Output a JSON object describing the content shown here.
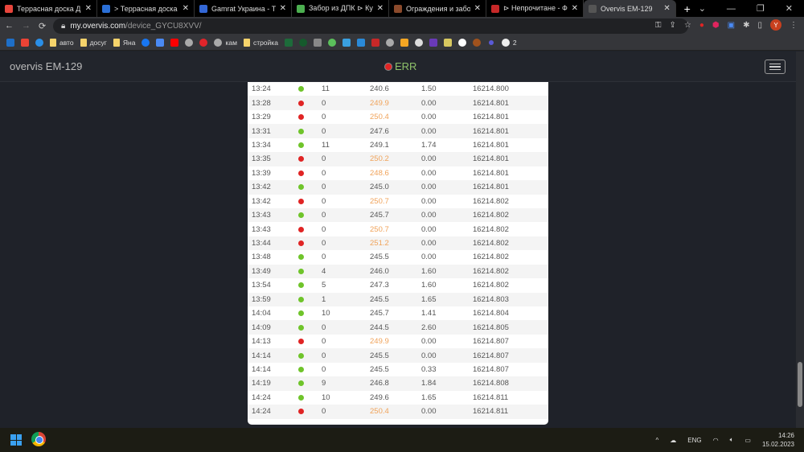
{
  "browser": {
    "tabs": [
      {
        "title": "Террасная доска ДПК I",
        "color": "#e8453c"
      },
      {
        "title": "> Террасная доска • К",
        "color": "#2a6fd6"
      },
      {
        "title": "Gamrat Украина - Терр",
        "color": "#3367d6"
      },
      {
        "title": "Забор из ДПК ⊳ Купит",
        "color": "#4caf50"
      },
      {
        "title": "Ограждения и заборы",
        "color": "#8b4a2b"
      },
      {
        "title": "⊳ Непрочитане - Фору",
        "color": "#c62828"
      },
      {
        "title": "Overvis EM-129",
        "color": "#555",
        "active": true
      }
    ],
    "url_host": "my.overvis.com",
    "url_path": "/device_GYCU8XVV/",
    "profile_initial": "Y",
    "bookmarks": [
      "авто",
      "досуг",
      "Яна",
      "кам",
      "стройка"
    ],
    "bookmark_count": "2"
  },
  "app": {
    "brand": "overvis EM-129",
    "status": "ERR"
  },
  "table": {
    "rows": [
      [
        "13:24",
        "ok",
        "11",
        "240.6",
        "1.50",
        "16214.800"
      ],
      [
        "13:28",
        "err",
        "0",
        "249.9",
        "0.00",
        "16214.801"
      ],
      [
        "13:29",
        "err",
        "0",
        "250.4",
        "0.00",
        "16214.801"
      ],
      [
        "13:31",
        "ok",
        "0",
        "247.6",
        "0.00",
        "16214.801"
      ],
      [
        "13:34",
        "ok",
        "11",
        "249.1",
        "1.74",
        "16214.801"
      ],
      [
        "13:35",
        "err",
        "0",
        "250.2",
        "0.00",
        "16214.801"
      ],
      [
        "13:39",
        "err",
        "0",
        "248.6",
        "0.00",
        "16214.801"
      ],
      [
        "13:42",
        "ok",
        "0",
        "245.0",
        "0.00",
        "16214.801"
      ],
      [
        "13:42",
        "err",
        "0",
        "250.7",
        "0.00",
        "16214.802"
      ],
      [
        "13:43",
        "ok",
        "0",
        "245.7",
        "0.00",
        "16214.802"
      ],
      [
        "13:43",
        "err",
        "0",
        "250.7",
        "0.00",
        "16214.802"
      ],
      [
        "13:44",
        "err",
        "0",
        "251.2",
        "0.00",
        "16214.802"
      ],
      [
        "13:48",
        "ok",
        "0",
        "245.5",
        "0.00",
        "16214.802"
      ],
      [
        "13:49",
        "ok",
        "4",
        "246.0",
        "1.60",
        "16214.802"
      ],
      [
        "13:54",
        "ok",
        "5",
        "247.3",
        "1.60",
        "16214.802"
      ],
      [
        "13:59",
        "ok",
        "1",
        "245.5",
        "1.65",
        "16214.803"
      ],
      [
        "14:04",
        "ok",
        "10",
        "245.7",
        "1.41",
        "16214.804"
      ],
      [
        "14:09",
        "ok",
        "0",
        "244.5",
        "2.60",
        "16214.805"
      ],
      [
        "14:13",
        "err",
        "0",
        "249.9",
        "0.00",
        "16214.807"
      ],
      [
        "14:14",
        "ok",
        "0",
        "245.5",
        "0.00",
        "16214.807"
      ],
      [
        "14:14",
        "ok",
        "0",
        "245.5",
        "0.33",
        "16214.807"
      ],
      [
        "14:19",
        "ok",
        "9",
        "246.8",
        "1.84",
        "16214.808"
      ],
      [
        "14:24",
        "ok",
        "10",
        "249.6",
        "1.65",
        "16214.811"
      ],
      [
        "14:24",
        "err",
        "0",
        "250.4",
        "0.00",
        "16214.811"
      ]
    ]
  },
  "colors": {
    "ok": "#6fc42a",
    "err": "#e02424",
    "warn": "#f0a35a"
  },
  "taskbar": {
    "lang": "ENG",
    "time": "14:26",
    "date": "15.02.2023"
  }
}
